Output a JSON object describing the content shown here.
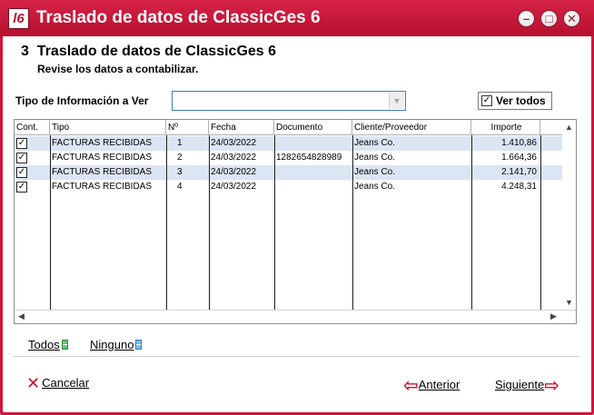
{
  "window": {
    "title": "Traslado de datos de ClassicGes 6",
    "icon_text": "l6",
    "controls": {
      "minimize": "–",
      "maximize": "□",
      "close": "✕"
    }
  },
  "header": {
    "step_number": "3",
    "title": "Traslado de datos de ClassicGes 6",
    "subtitle": "Revise los datos a contabilizar."
  },
  "filter": {
    "label": "Tipo de Información a Ver",
    "value": "",
    "ver_todos_label": "Ver todos",
    "ver_todos_checked": true
  },
  "table": {
    "columns": [
      "Cont.",
      "Tipo",
      "Nº",
      "Fecha",
      "Documento",
      "Cliente/Proveedor",
      "Importe"
    ],
    "rows": [
      {
        "checked": true,
        "tipo": "FACTURAS RECIBIDAS",
        "num": "1",
        "fecha": "24/03/2022",
        "documento": "",
        "cliente": "Jeans Co.",
        "importe": "1.410,86"
      },
      {
        "checked": true,
        "tipo": "FACTURAS RECIBIDAS",
        "num": "2",
        "fecha": "24/03/2022",
        "documento": "1282654828989",
        "cliente": "Jeans Co.",
        "importe": "1.664,36"
      },
      {
        "checked": true,
        "tipo": "FACTURAS RECIBIDAS",
        "num": "3",
        "fecha": "24/03/2022",
        "documento": "",
        "cliente": "Jeans Co.",
        "importe": "2.141,70"
      },
      {
        "checked": true,
        "tipo": "FACTURAS RECIBIDAS",
        "num": "4",
        "fecha": "24/03/2022",
        "documento": "",
        "cliente": "Jeans Co.",
        "importe": "4.248,31"
      }
    ]
  },
  "selection": {
    "todos_label": "Todos",
    "ninguno_label": "Ninguno"
  },
  "footer": {
    "cancel_label": "Cancelar",
    "back_label": "Anterior",
    "next_label": "Siguiente"
  },
  "colors": {
    "title_bar": "#c8173b",
    "accent_red": "#d0132f",
    "row_alt": "#dbe5f4"
  }
}
